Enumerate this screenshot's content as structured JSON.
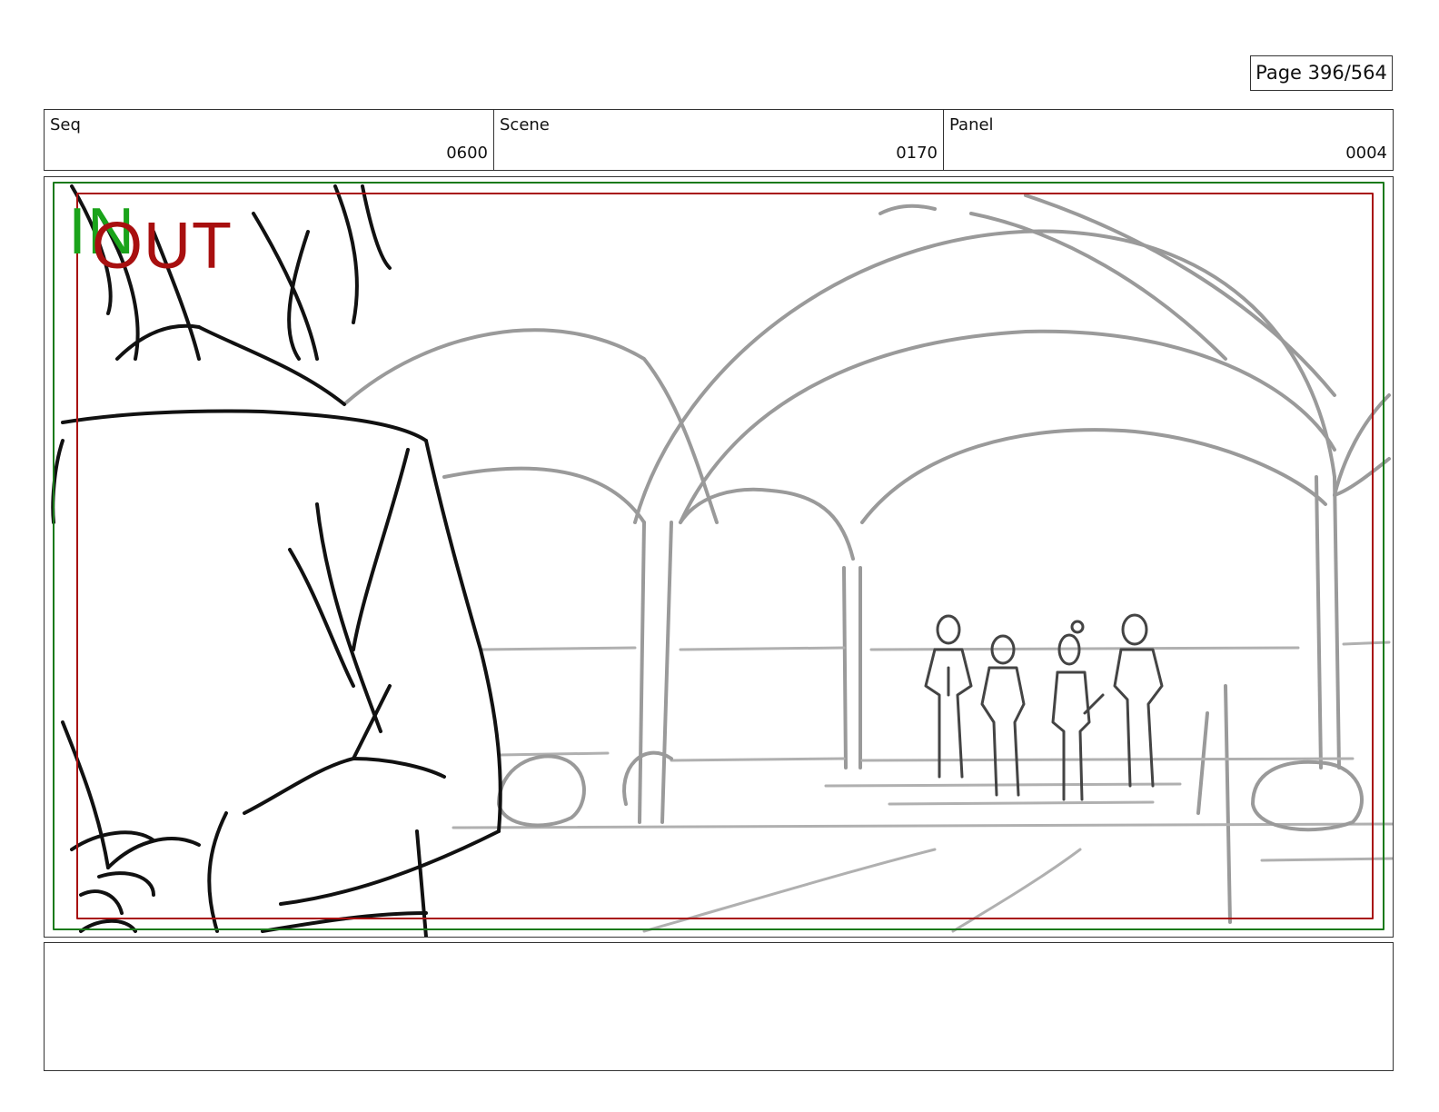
{
  "page": {
    "label": "Page 396/564"
  },
  "header": {
    "seq": {
      "label": "Seq",
      "value": "0600"
    },
    "scene": {
      "label": "Scene",
      "value": "0170"
    },
    "panel": {
      "label": "Panel",
      "value": "0004"
    }
  },
  "panel_image": {
    "in_label": "IN",
    "out_label": "OUT",
    "in_frame_color": "#1aa31a",
    "out_frame_color": "#a80f0f",
    "subject": "storyboard sketch: character seen from behind in foreground, four figures standing beneath arched colonnade"
  },
  "notes": {
    "text": ""
  }
}
